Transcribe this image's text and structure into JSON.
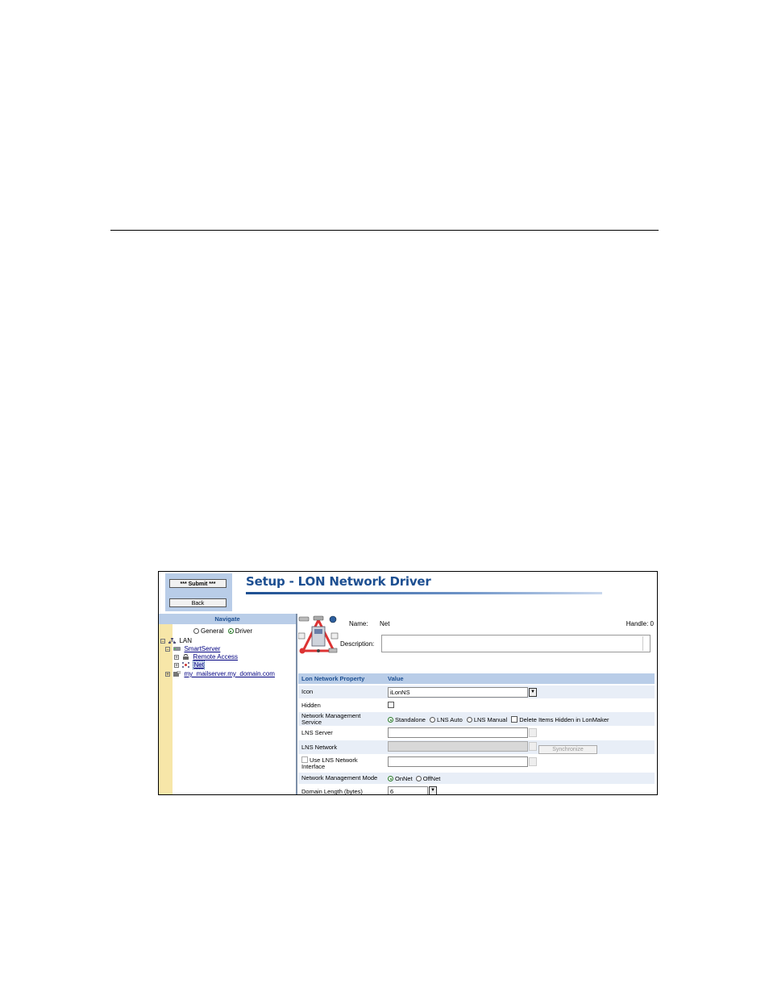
{
  "screenshot": {
    "buttons": {
      "submit_label": "*** Submit ***",
      "back_label": "Back"
    },
    "title": "Setup - LON Network Driver",
    "nav": {
      "header": "Navigate",
      "radio_general": "General",
      "radio_driver": "Driver",
      "selected_radio": "Driver",
      "tree": [
        {
          "label": "LAN",
          "expander": "−",
          "icon": "network-icon"
        },
        {
          "label": "SmartServer",
          "expander": "−",
          "icon": "server-icon"
        },
        {
          "label": "Remote Access",
          "expander": "+",
          "icon": "modem-icon"
        },
        {
          "label": "Net",
          "expander": "+",
          "icon": "lon-network-icon",
          "selected": true
        },
        {
          "label": "my_mailserver.my_domain.com",
          "expander": "+",
          "icon": "mailserver-icon"
        }
      ]
    },
    "details": {
      "name_label": "Name:",
      "name_value": "Net",
      "handle": "Handle: 0",
      "description_label": "Description:"
    },
    "grid": {
      "col_property": "Lon Network Property",
      "col_value": "Value",
      "icon_label": "Icon",
      "icon_value": "iLonNS",
      "hidden_label": "Hidden",
      "nms_label": "Network Management Service",
      "nms_options": [
        "Standalone",
        "LNS Auto",
        "LNS Manual"
      ],
      "nms_selected": "Standalone",
      "delete_hidden_label": "Delete Items Hidden in LonMaker",
      "lns_server_label": "LNS Server",
      "lns_network_label": "LNS Network",
      "sync_label": "Synchronize",
      "use_lns_label": "Use LNS Network Interface",
      "nm_mode_label": "Network Management Mode",
      "nm_mode_options": [
        "OnNet",
        "OffNet"
      ],
      "nm_mode_selected": "OnNet",
      "domain_length_label": "Domain Length (bytes)",
      "domain_length_value": "6",
      "dropdown_glyph": "▼"
    }
  }
}
